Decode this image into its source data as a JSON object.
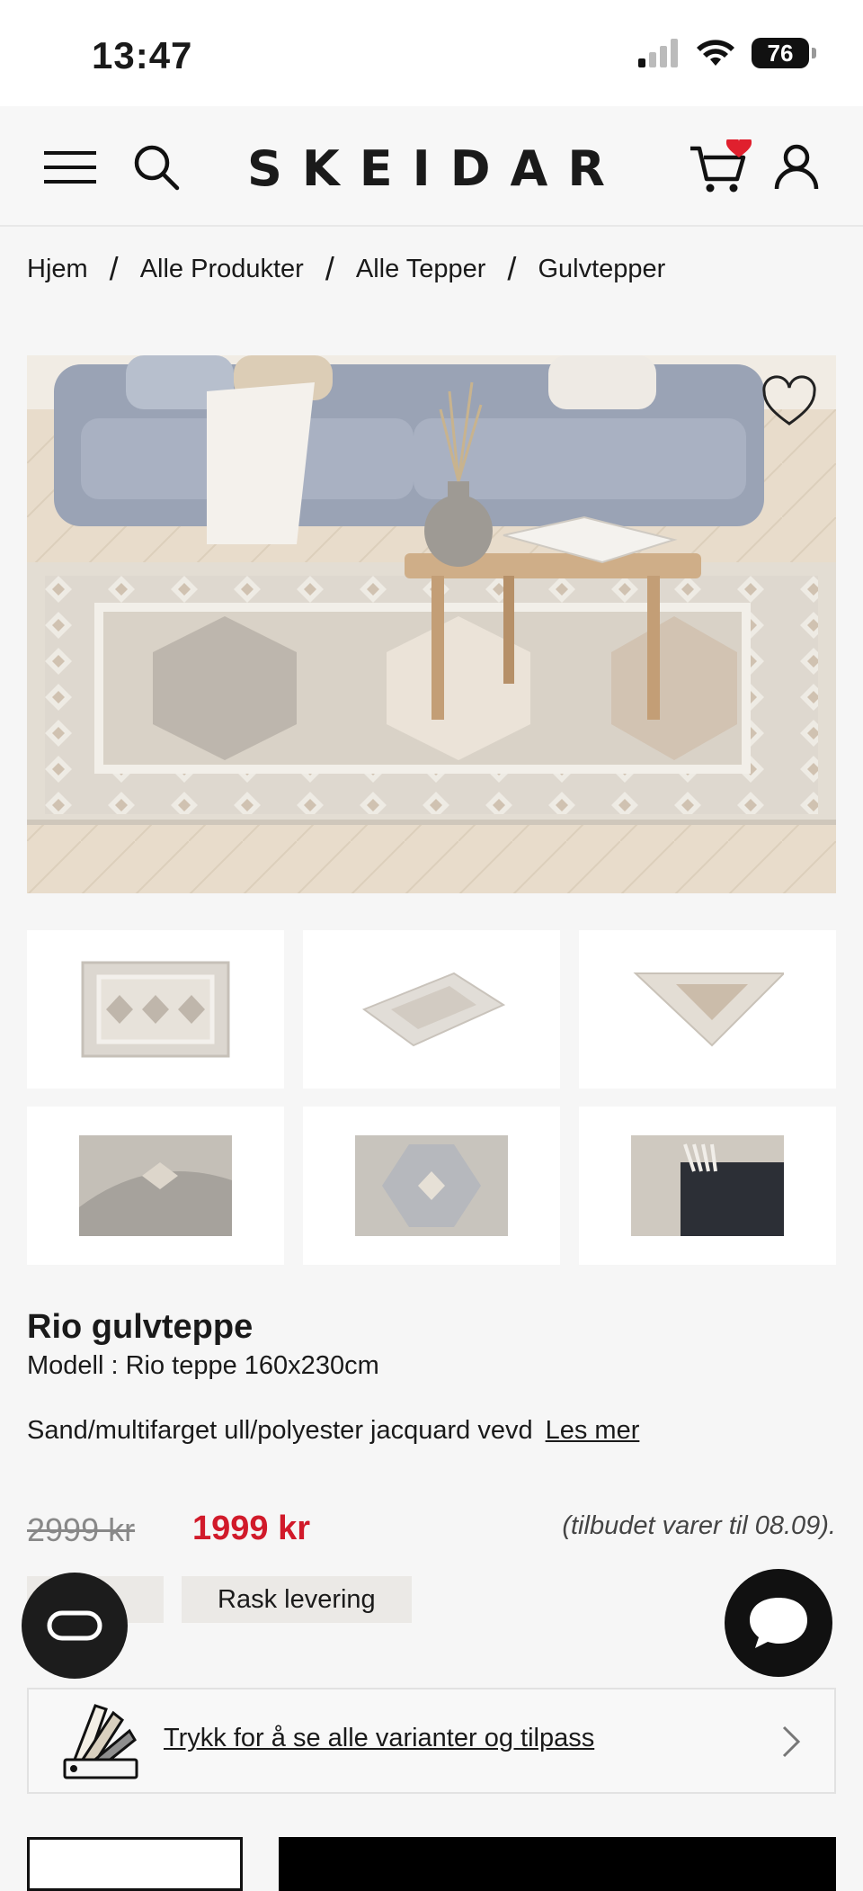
{
  "status": {
    "time": "13:47",
    "battery": "76"
  },
  "header": {
    "logo": "SKEIDAR"
  },
  "breadcrumb": [
    "Hjem",
    "/",
    "Alle Produkter",
    "/",
    "Alle Tepper",
    "/",
    "Gulvtepper"
  ],
  "product": {
    "title": "Rio gulvteppe",
    "model": "Modell : Rio teppe 160x230cm",
    "description": "Sand/multifarget ull/polyester jacquard vevd",
    "read_more": "Les mer",
    "old_price": "2999 kr",
    "new_price": "1999 kr",
    "offer_note": "(tilbudet varer til 08.09).",
    "badges": [
      "K",
      "Rask levering"
    ],
    "variants_link": "Trykk for å se alle varianter og tilpass"
  },
  "colors": {
    "accent_red": "#d11a2a",
    "cart_heart": "#e0202e"
  },
  "icons": [
    "menu-icon",
    "search-icon",
    "cart-icon",
    "heart-badge-icon",
    "user-icon",
    "heart-icon",
    "chat-icon",
    "message-icon",
    "swatch-icon",
    "chevron-right-icon"
  ]
}
